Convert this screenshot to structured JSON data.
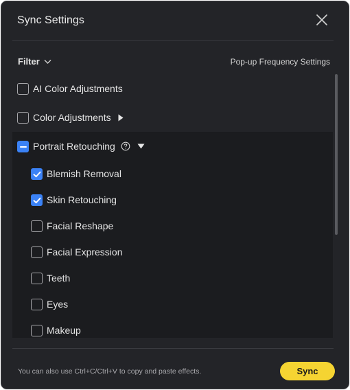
{
  "dialog": {
    "title": "Sync Settings"
  },
  "toolbar": {
    "filter_label": "Filter",
    "popup_frequency_label": "Pop-up Frequency Settings"
  },
  "items": [
    {
      "label": "AI Color Adjustments",
      "state": "unchecked"
    },
    {
      "label": "Color Adjustments",
      "state": "unchecked",
      "expandable": "collapsed"
    },
    {
      "label": "Portrait Retouching",
      "state": "mixed",
      "expandable": "expanded",
      "help": true
    }
  ],
  "subitems": [
    {
      "label": "Blemish Removal",
      "state": "checked"
    },
    {
      "label": "Skin Retouching",
      "state": "checked"
    },
    {
      "label": "Facial Reshape",
      "state": "unchecked"
    },
    {
      "label": "Facial Expression",
      "state": "unchecked"
    },
    {
      "label": "Teeth",
      "state": "unchecked"
    },
    {
      "label": "Eyes",
      "state": "unchecked"
    },
    {
      "label": "Makeup",
      "state": "unchecked"
    }
  ],
  "footer": {
    "hint": "You can also use Ctrl+C/Ctrl+V to copy and paste effects.",
    "sync_label": "Sync"
  },
  "colors": {
    "accent": "#3b82f6",
    "sync_button": "#f5d432",
    "panel_bg": "#232428"
  }
}
